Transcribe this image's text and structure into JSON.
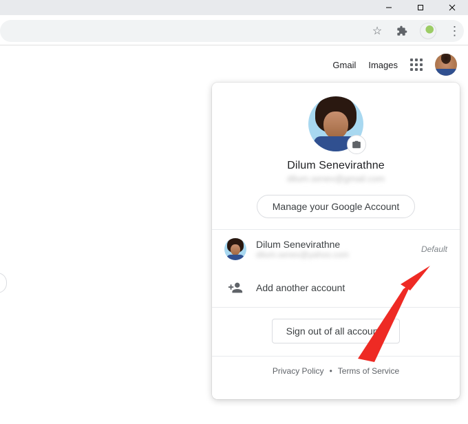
{
  "header": {
    "links": {
      "gmail": "Gmail",
      "images": "Images"
    }
  },
  "popup": {
    "name": "Dilum Senevirathne",
    "email": "dilum.senev@gmail.com",
    "manage": "Manage your Google Account",
    "accounts": [
      {
        "name": "Dilum Senevirathne",
        "email": "dilum.senev@yahoo.com",
        "tag": "Default"
      }
    ],
    "add": "Add another account",
    "signout": "Sign out of all accounts",
    "footer": {
      "privacy": "Privacy Policy",
      "terms": "Terms of Service"
    }
  }
}
